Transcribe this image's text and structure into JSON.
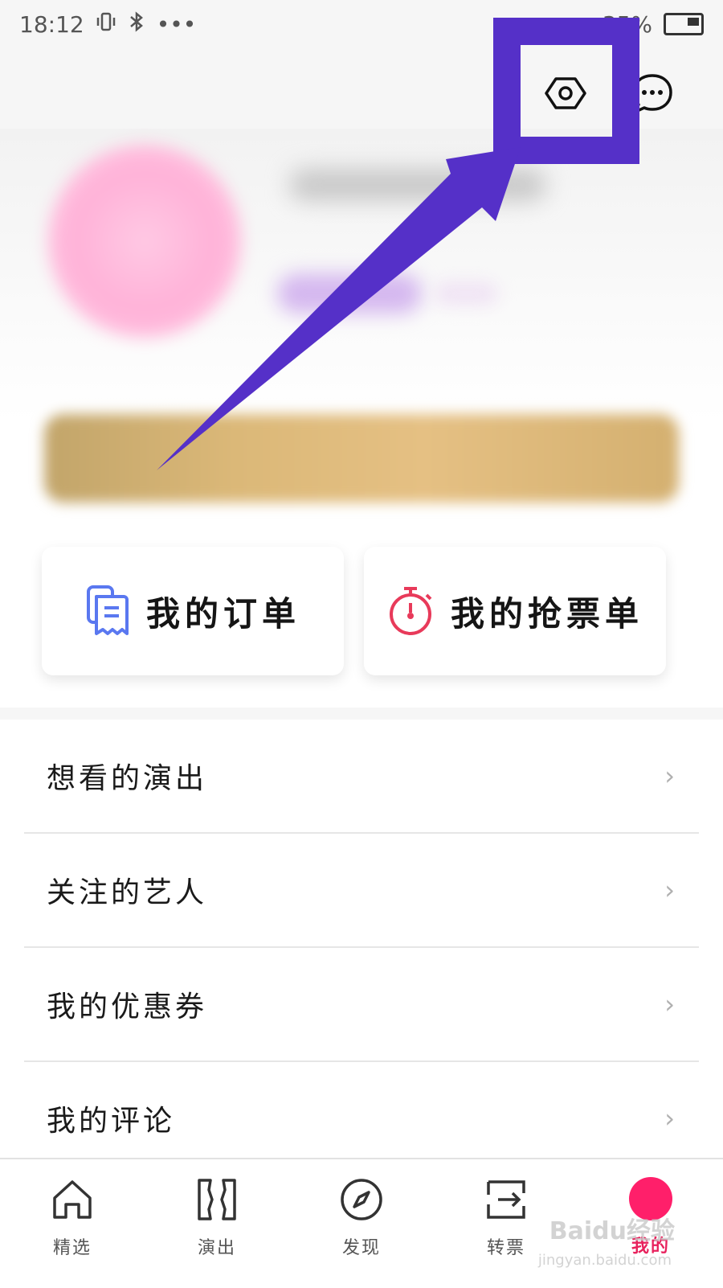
{
  "status_bar": {
    "time": "18:12",
    "dots": "•••",
    "battery_text": "35%"
  },
  "cards": {
    "orders_label": "我的订单",
    "grab_tickets_label": "我的抢票单"
  },
  "menu": {
    "items": [
      {
        "label": "想看的演出"
      },
      {
        "label": "关注的艺人"
      },
      {
        "label": "我的优惠券"
      },
      {
        "label": "我的评论"
      }
    ],
    "chevron": "›"
  },
  "tabbar": {
    "items": [
      {
        "label": "精选",
        "icon": "home-icon"
      },
      {
        "label": "演出",
        "icon": "ticket-icon"
      },
      {
        "label": "发现",
        "icon": "compass-icon"
      },
      {
        "label": "转票",
        "icon": "transfer-icon"
      },
      {
        "label": "我的",
        "icon": "profile-icon"
      }
    ],
    "active_index": 4
  },
  "watermark": {
    "text": "Baidu经验",
    "sub": "jingyan.baidu.com"
  },
  "colors": {
    "accent": "#e8225d",
    "annotation": "#5530c8",
    "order_icon": "#5a78f0",
    "timer_icon": "#e83a5a"
  }
}
